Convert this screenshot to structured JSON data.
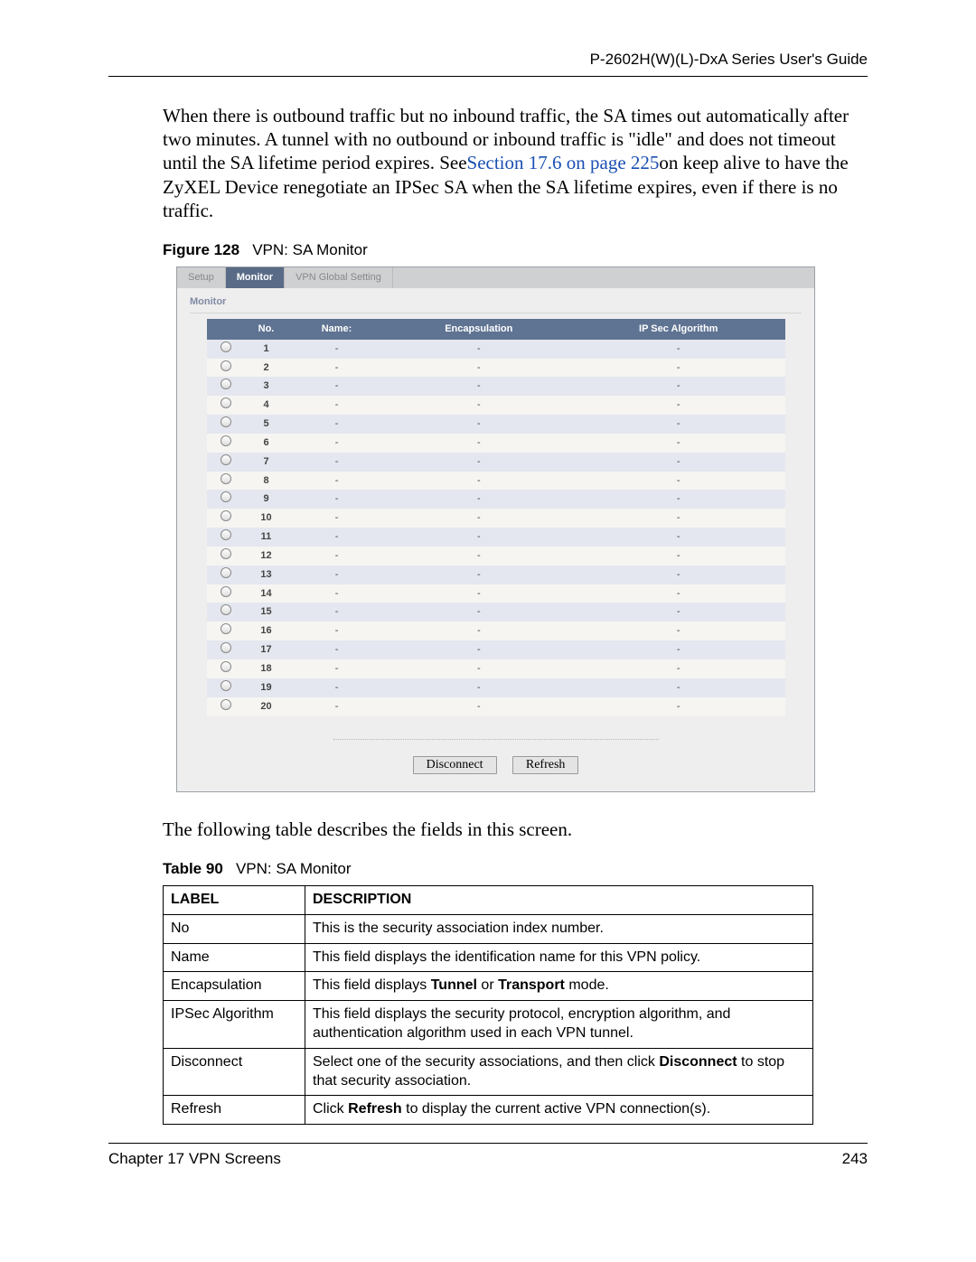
{
  "running_head": "P-2602H(W)(L)-DxA Series User's Guide",
  "paragraph": {
    "pre": "When there is outbound traffic but no inbound traffic, the SA times out automatically after two minutes. A tunnel with no outbound or inbound traffic is \"idle\" and does not timeout until the SA lifetime period expires. See",
    "link": "Section 17.6 on page 225",
    "post": "on keep alive to have the ZyXEL Device renegotiate an IPSec SA when the SA lifetime expires, even if there is no traffic."
  },
  "figure": {
    "label": "Figure 128",
    "title": "VPN: SA Monitor"
  },
  "ui": {
    "tabs": [
      "Setup",
      "Monitor",
      "VPN Global Setting"
    ],
    "subhead": "Monitor",
    "cols": [
      "",
      "No.",
      "Name:",
      "Encapsulation",
      "IP Sec Algorithm"
    ],
    "row_count": 20,
    "btn_disconnect": "Disconnect",
    "btn_refresh": "Refresh"
  },
  "mid_para": "The following table describes the fields in this screen.",
  "table_caption": {
    "label": "Table 90",
    "title": "VPN: SA Monitor"
  },
  "desc": {
    "head_label": "LABEL",
    "head_desc": "DESCRIPTION",
    "rows": [
      {
        "label": "No",
        "html": "This is the security association index number."
      },
      {
        "label": "Name",
        "html": "This field displays the identification name for this VPN policy."
      },
      {
        "label": "Encapsulation",
        "html": "This field displays <b>Tunnel</b> or <b>Transport</b> mode."
      },
      {
        "label": "IPSec Algorithm",
        "html": "This field displays the security protocol, encryption algorithm, and authentication algorithm used in each VPN tunnel."
      },
      {
        "label": "Disconnect",
        "html": "Select one of the security associations, and then click <b>Disconnect</b> to stop that security association."
      },
      {
        "label": "Refresh",
        "html": "Click <b>Refresh</b> to display the current active VPN connection(s)."
      }
    ]
  },
  "footer": {
    "left": "Chapter 17 VPN Screens",
    "right": "243"
  }
}
